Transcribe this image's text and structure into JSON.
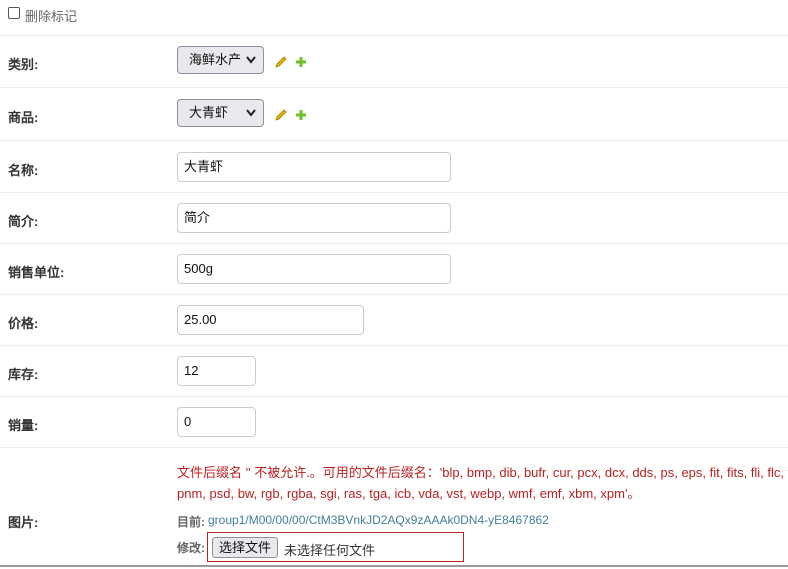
{
  "delete": {
    "label": "删除标记",
    "checked": false
  },
  "fields": {
    "category": {
      "label": "类别:",
      "value": "海鲜水产"
    },
    "product": {
      "label": "商品:",
      "value": "大青虾"
    },
    "name": {
      "label": "名称:",
      "value": "大青虾"
    },
    "intro": {
      "label": "简介:",
      "value": "简介"
    },
    "unit": {
      "label": "销售单位:",
      "value": "500g"
    },
    "price": {
      "label": "价格:",
      "value": "25.00"
    },
    "stock": {
      "label": "库存:",
      "value": "12"
    },
    "sales": {
      "label": "销量:",
      "value": "0"
    }
  },
  "image": {
    "label": "图片:",
    "error_line1": "文件后缀名 '' 不被允许.。可用的文件后缀名：'blp, bmp, dib, bufr, cur, pcx, dcx, dds, ps, eps, fit, fits, fli, flc, ft",
    "error_line2": "pnm, psd, bw, rgb, rgba, sgi, ras, tga, icb, vda, vst, webp, wmf, emf, xbm, xpm'。",
    "current_label": "目前:",
    "current_link": "group1/M00/00/00/CtM3BVnkJD2AQx9zAAAk0DN4-yE8467862",
    "change_label": "修改:",
    "file_button": "选择文件",
    "file_status": "未选择任何文件"
  },
  "icons": {
    "edit": "pencil-icon",
    "add": "plus-icon"
  },
  "colors": {
    "error": "#ba2121",
    "link": "#447e9b",
    "pencil": "#e0b400",
    "plus": "#70bf2b"
  }
}
